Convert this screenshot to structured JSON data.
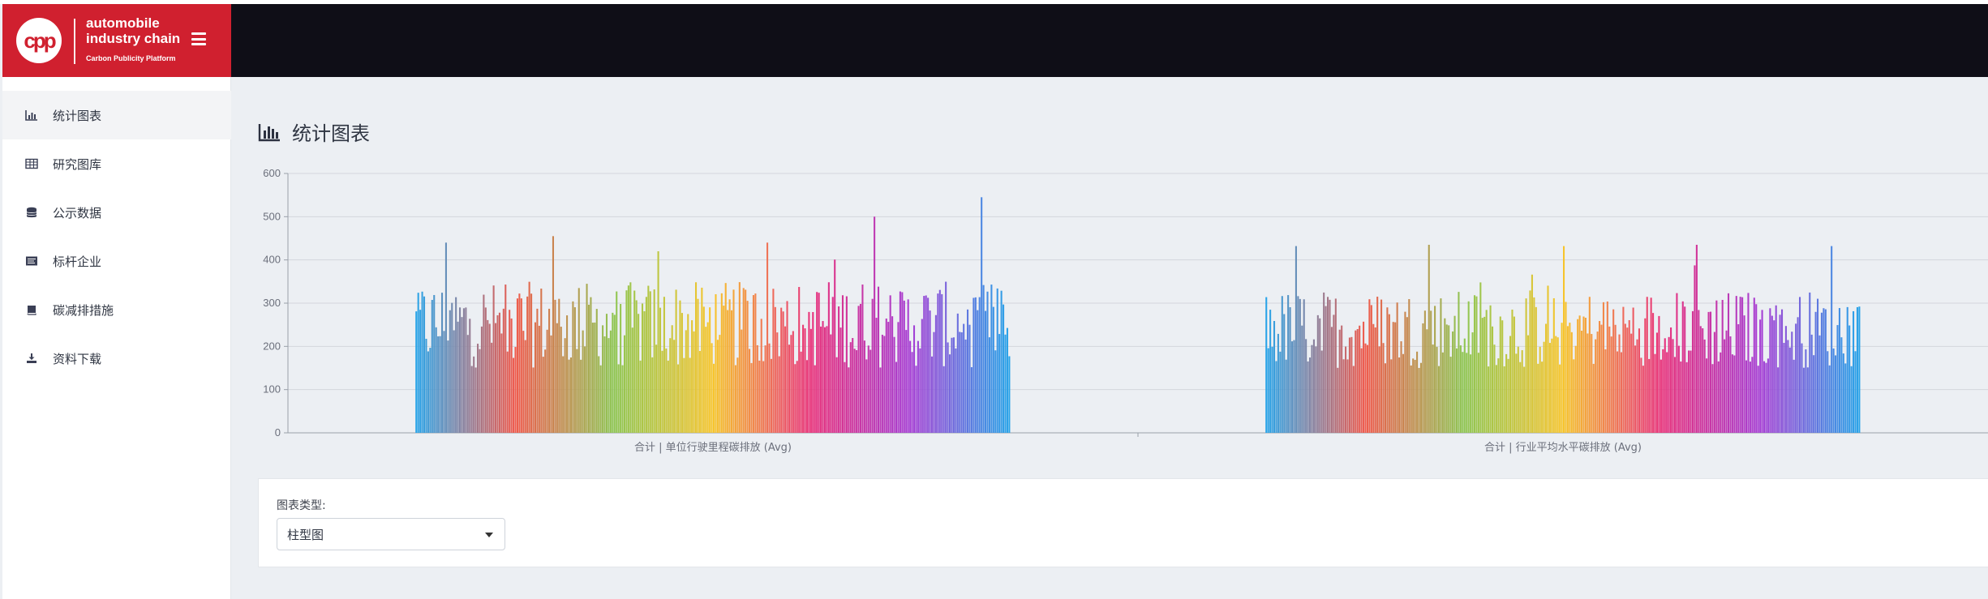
{
  "brand": {
    "logo_text": "cpp",
    "line1": "automobile",
    "line2": "industry chain",
    "subtitle": "Carbon Publicity Platform"
  },
  "sidebar": {
    "items": [
      {
        "label": "统计图表",
        "icon": "bar-chart-icon",
        "active": true
      },
      {
        "label": "研究图库",
        "icon": "table-icon",
        "active": false
      },
      {
        "label": "公示数据",
        "icon": "database-icon",
        "active": false
      },
      {
        "label": "标杆企业",
        "icon": "list-icon",
        "active": false
      },
      {
        "label": "碳减排措施",
        "icon": "book-icon",
        "active": false
      },
      {
        "label": "资料下载",
        "icon": "download-icon",
        "active": false
      }
    ]
  },
  "main": {
    "title": "统计图表",
    "options": {
      "chart_type_label": "图表类型:",
      "chart_type_value": "柱型图"
    }
  },
  "colors": {
    "brand_red": "#d0202f",
    "topbar": "#0f0e17",
    "background": "#eceff3",
    "gradient_stops": [
      "#2aa4e8",
      "#ef5b4d",
      "#8fc653",
      "#f7c52b",
      "#e8307a",
      "#a63fd4",
      "#2aa4e8"
    ]
  },
  "chart_data": {
    "type": "bar",
    "ylim": [
      0,
      600
    ],
    "yticks": [
      0,
      100,
      200,
      300,
      400,
      500,
      600
    ],
    "grid": true,
    "categories": [
      "合计 | 单位行驶里程碳排放 (Avg)",
      "合计 | 行业平均水平碳排放 (Avg)"
    ],
    "series": [
      {
        "bar_count": 300,
        "typical_range": [
          150,
          350
        ],
        "peaks": [
          440,
          455,
          420,
          440,
          500,
          545
        ]
      },
      {
        "bar_count": 300,
        "typical_range": [
          150,
          330
        ],
        "peaks": [
          432,
          435,
          432,
          435,
          432
        ]
      }
    ]
  }
}
